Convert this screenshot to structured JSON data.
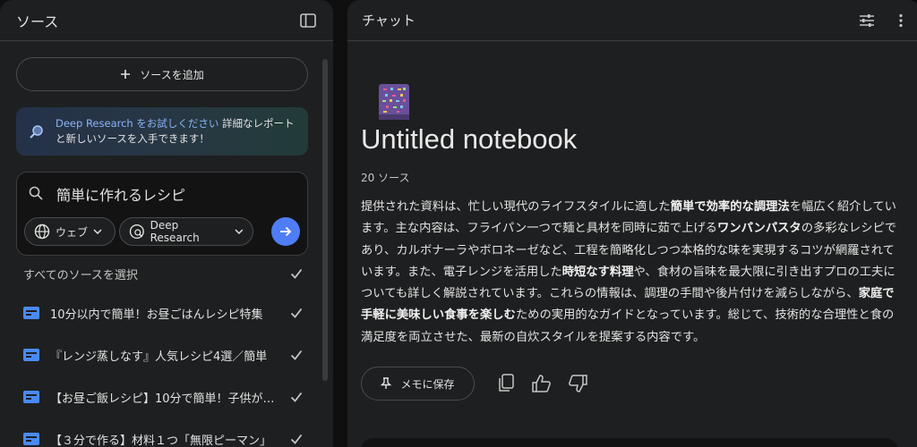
{
  "sources_panel": {
    "title": "ソース",
    "add_source_label": "ソースを追加",
    "promo": {
      "link_text": "Deep Research をお試しください",
      "body_text": " 詳細なレポートと新しいソースを入手できます！"
    },
    "search": {
      "query": "簡単に作れるレシピ",
      "chip_web": "ウェブ",
      "chip_deep": "Deep Research"
    },
    "select_all_label": "すべてのソースを選択",
    "items": [
      {
        "title": "10分以内で簡単！お昼ごはんレシピ特集"
      },
      {
        "title": "『レンジ蒸しなす』人気レシピ4選／簡単"
      },
      {
        "title": "【お昼ご飯レシピ】10分で簡単！子供が喜ぶ"
      },
      {
        "title": "【３分で作る】材料１つ「無限ピーマン」"
      }
    ]
  },
  "chat_panel": {
    "title": "チャット",
    "notebook_title": "Untitled notebook",
    "source_count": "20 ソース",
    "summary": {
      "t1": "提供された資料は、忙しい現代のライフスタイルに適した",
      "b1": "簡単で効率的な調理法",
      "t2": "を幅広く紹介しています。主な内容は、フライパン一つで麺と具材を同時に茹で上げる",
      "b2": "ワンパンパスタ",
      "t3": "の多彩なレシピであり、カルボナーラやボロネーゼなど、工程を簡略化しつつ本格的な味を実現するコツが網羅されています。また、電子レンジを活用した",
      "b3": "時短なす料理",
      "t4": "や、食材の旨味を最大限に引き出すプロの工夫についても詳しく解説されています。これらの情報は、調理の手間や後片付けを減らしながら、",
      "b4": "家庭で手軽に美味しい食事を楽しむ",
      "t5": "ための実用的なガイドとなっています。総じて、技術的な合理性と食の満足度を両立させた、最新の自炊スタイルを提案する内容です。"
    },
    "save_note_label": "メモに保存"
  },
  "colors": {
    "accent": "#4f7df5",
    "link": "#8ab4f8",
    "source_icon": "#4a8af4"
  }
}
